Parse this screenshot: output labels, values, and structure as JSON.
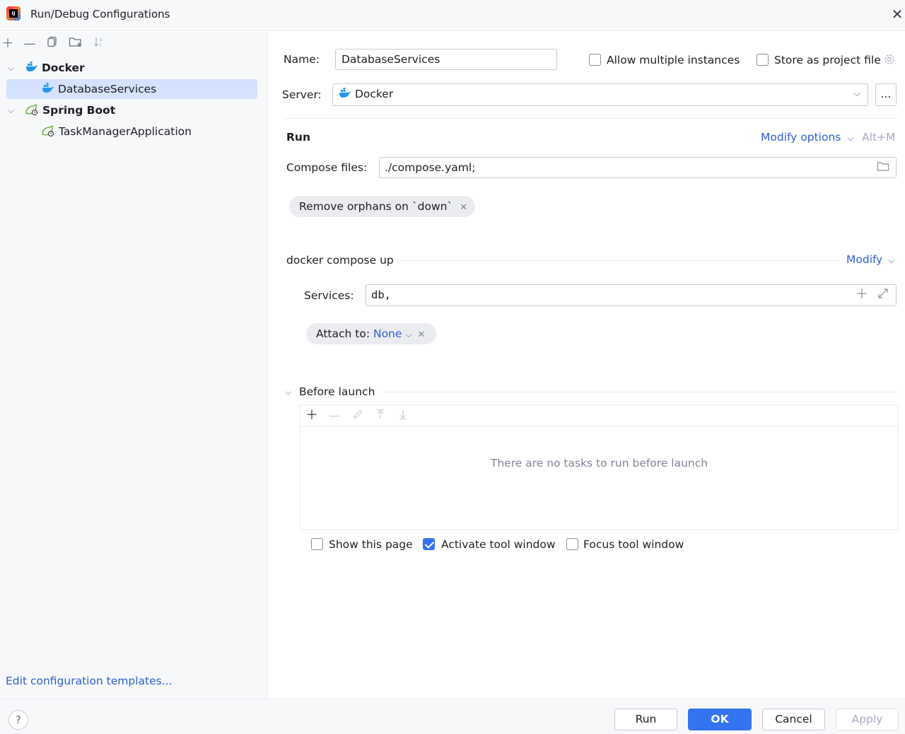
{
  "window": {
    "title": "Run/Debug Configurations"
  },
  "sidebar": {
    "tree": [
      {
        "label": "Docker",
        "children": [
          {
            "label": "DatabaseServices"
          }
        ]
      },
      {
        "label": "Spring Boot",
        "children": [
          {
            "label": "TaskManagerApplication"
          }
        ]
      }
    ],
    "edit_templates_link": "Edit configuration templates..."
  },
  "form": {
    "name_label": "Name:",
    "name_value": "DatabaseServices",
    "allow_multiple_label": "Allow multiple instances",
    "store_as_project_label": "Store as project file",
    "server_label": "Server:",
    "server_value": "Docker",
    "server_more": "...",
    "run_section": "Run",
    "modify_options": "Modify options",
    "modify_shortcut": "Alt+M",
    "compose_files_label": "Compose files:",
    "compose_files_value": "./compose.yaml;",
    "remove_orphans_chip": "Remove orphans on `down`",
    "compose_up_section": "docker compose up",
    "modify_link": "Modify",
    "services_label": "Services:",
    "services_value": "db,",
    "attach_to_label": "Attach to:",
    "attach_to_value": "None",
    "before_launch": "Before launch",
    "no_tasks": "There are no tasks to run before launch",
    "show_page_label": "Show this page",
    "activate_tool_label": "Activate tool window",
    "focus_tool_label": "Focus tool window"
  },
  "checkboxes": {
    "allow_multiple": false,
    "store_as_project": false,
    "show_page": false,
    "activate_tool": true,
    "focus_tool": false
  },
  "buttons": {
    "run": "Run",
    "ok": "OK",
    "cancel": "Cancel",
    "apply": "Apply",
    "help": "?"
  },
  "colors": {
    "accent": "#3574f0",
    "link": "#2f5fd3",
    "selection": "#d4e2ff",
    "docker_blue": "#2496ed",
    "spring_green": "#6db33f"
  },
  "icons": [
    "add-icon",
    "remove-icon",
    "copy-icon",
    "new-folder-icon",
    "sort-icon",
    "docker-icon",
    "spring-boot-icon",
    "gear-icon",
    "folder-icon",
    "expand-icon",
    "edit-icon",
    "move-up-icon",
    "move-down-icon",
    "close-icon",
    "help-icon"
  ]
}
